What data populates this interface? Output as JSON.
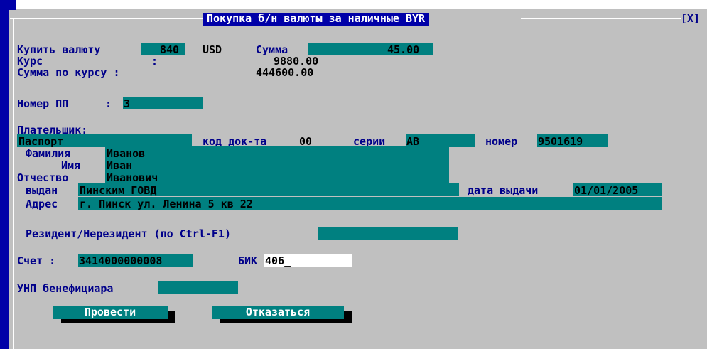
{
  "window": {
    "title": "Покупка б/н валюты за наличные BYR",
    "close": "[X]"
  },
  "currency": {
    "label": "Купить валюту",
    "code": "840",
    "iso": "USD",
    "amount_label": "Сумма",
    "amount": "45.00"
  },
  "rate": {
    "label": "Курс",
    "colon": ":",
    "value": "9880.00"
  },
  "sum_rate": {
    "label": "Сумма по курсу :",
    "value": "444600.00"
  },
  "pp": {
    "label": "Номер ПП",
    "colon": ":",
    "value": "3"
  },
  "payer": {
    "header": "Плательщик:",
    "doc_type": "Паспорт",
    "doc_code_label": "код док-та",
    "doc_code": "00",
    "series_label": "серии",
    "series": "АВ",
    "number_label": "номер",
    "number": "9501619",
    "lastname_label": "Фамилия",
    "lastname": "Иванов",
    "firstname_label": "Имя",
    "firstname": "Иван",
    "patronymic_label": "Отчество",
    "patronymic": "Иванович",
    "issued_label": "выдан",
    "issued": "Пинским ГОВД",
    "issue_date_label": "дата выдачи",
    "issue_date": "01/01/2005",
    "address_label": "Адрес",
    "address": "г. Пинск ул. Ленина 5 кв 22"
  },
  "resident": {
    "label": "Резидент/Нерезидент (по Ctrl-F1)",
    "value": ""
  },
  "account": {
    "label": "Счет :",
    "value": "3414000000008",
    "bik_label": "БИК",
    "bik": "406_"
  },
  "unp": {
    "label": "УНП бенефициара",
    "value": ""
  },
  "buttons": {
    "submit": "Провести",
    "cancel": "Отказаться"
  }
}
